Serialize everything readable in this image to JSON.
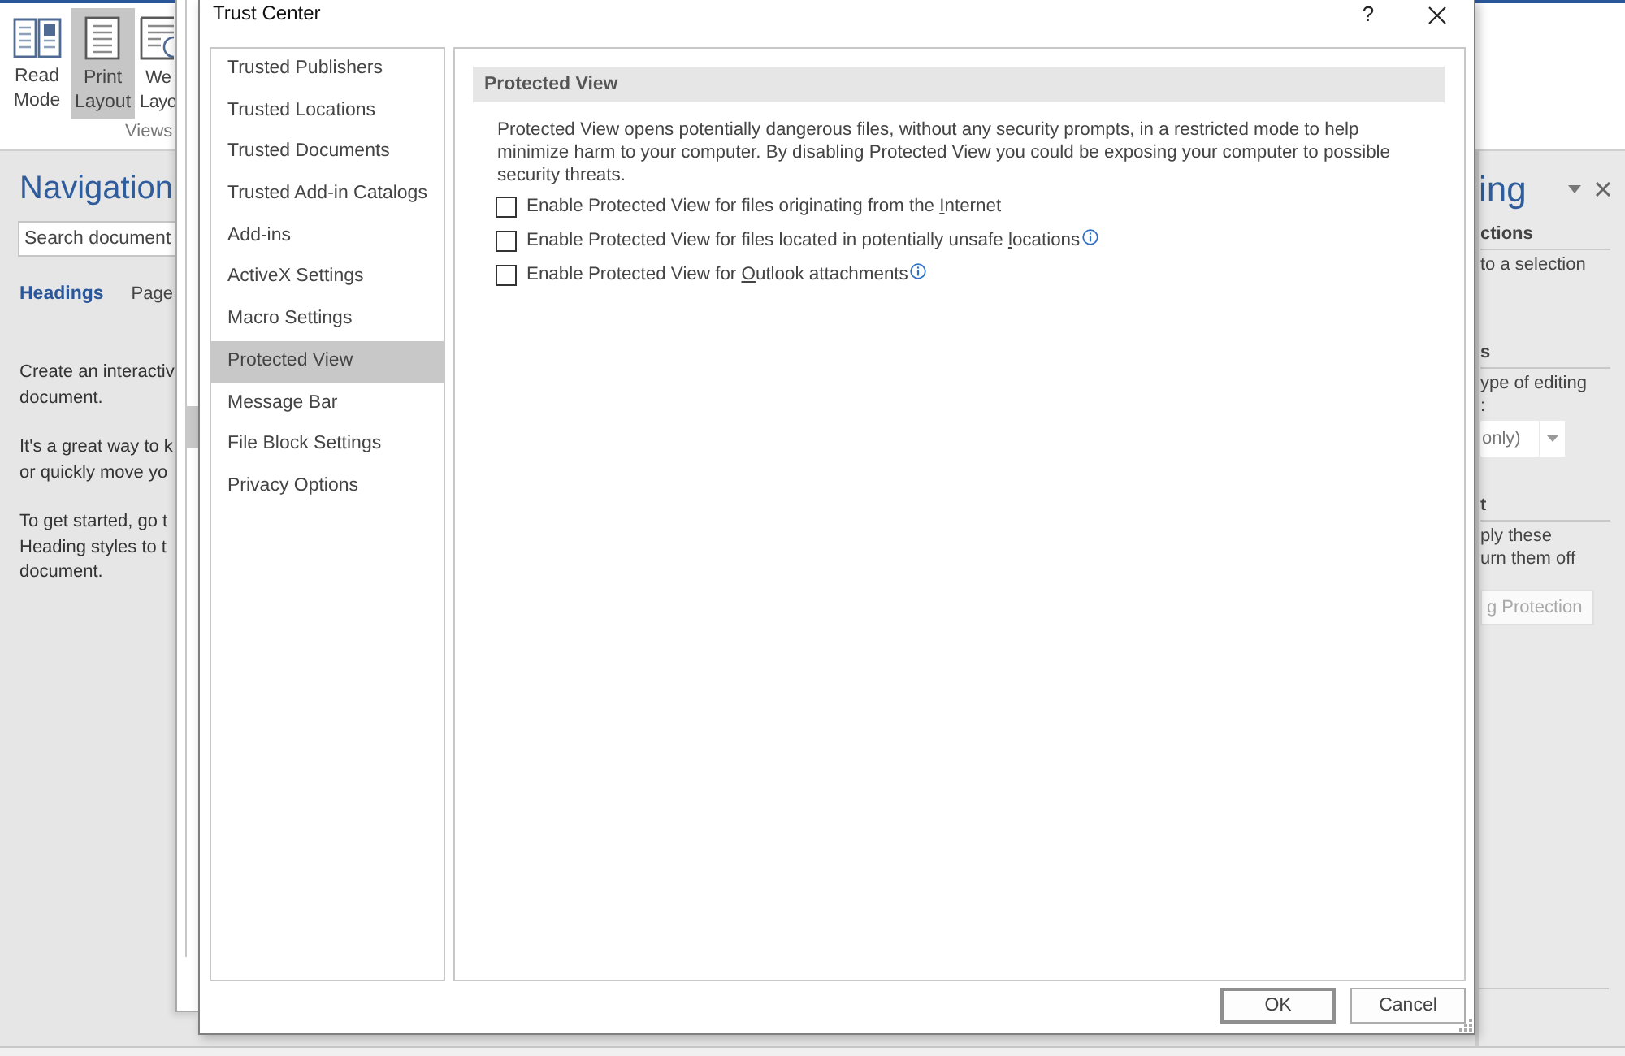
{
  "word_window": {
    "ribbon": {
      "views_group": {
        "label": "Views",
        "buttons": [
          {
            "kind": "read",
            "label_lines": [
              "Read",
              "Mode"
            ],
            "selected": false
          },
          {
            "kind": "print",
            "label_lines": [
              "Print",
              "Layout"
            ],
            "selected": true
          },
          {
            "kind": "web",
            "label_lines": [
              "We",
              "Layo"
            ],
            "selected": false
          }
        ]
      }
    },
    "navigation_pane": {
      "title": "Navigation",
      "search": {
        "placeholder": "Search document"
      },
      "tabs": [
        {
          "label": "Headings",
          "selected": true
        },
        {
          "label": "Page",
          "selected": false
        }
      ],
      "paragraphs": [
        {
          "lines": [
            "Create an interactiv",
            "document."
          ]
        },
        {
          "lines": [
            "It's a great way to k",
            "or quickly move yo"
          ]
        },
        {
          "lines": [
            "To get started, go t",
            "Heading styles to t",
            "document."
          ]
        }
      ]
    },
    "restrict_editing_pane": {
      "title": "ing",
      "sections": [
        {
          "heading": "ctions",
          "lines": [
            "to a selection"
          ]
        },
        {
          "heading": "s",
          "lines": [
            "ype of editing",
            ":"
          ],
          "dropdown": {
            "value": "only)"
          }
        },
        {
          "heading": "t",
          "lines": [
            "ply these",
            "urn them off"
          ],
          "button": {
            "label": "g Protection",
            "disabled": true
          }
        }
      ]
    }
  },
  "dialog": {
    "title": "Trust Center",
    "help_button": "?",
    "sidebar": {
      "items": [
        {
          "label": "Trusted Publishers",
          "selected": false
        },
        {
          "label": "Trusted Locations",
          "selected": false
        },
        {
          "label": "Trusted Documents",
          "selected": false
        },
        {
          "label": "Trusted Add-in Catalogs",
          "selected": false
        },
        {
          "label": "Add-ins",
          "selected": false
        },
        {
          "label": "ActiveX Settings",
          "selected": false
        },
        {
          "label": "Macro Settings",
          "selected": false
        },
        {
          "label": "Protected View",
          "selected": true
        },
        {
          "label": "Message Bar",
          "selected": false
        },
        {
          "label": "File Block Settings",
          "selected": false
        },
        {
          "label": "Privacy Options",
          "selected": false
        }
      ]
    },
    "content": {
      "heading": "Protected View",
      "description_lines": [
        "Protected View opens potentially dangerous files, without any security prompts, in a restricted mode to help",
        "minimize harm to your computer. By disabling Protected View you could be exposing your computer to possible",
        "security threats."
      ],
      "options": [
        {
          "before": "Enable Protected View for files originating from the ",
          "access_key": "I",
          "after": "nternet",
          "checked": false,
          "info_icon": false
        },
        {
          "before": "Enable Protected View for files located in potentially unsafe ",
          "access_key": "l",
          "after": "ocations",
          "checked": false,
          "info_icon": true
        },
        {
          "before": "Enable Protected View for ",
          "access_key": "O",
          "after": "utlook attachments",
          "checked": false,
          "info_icon": true
        }
      ]
    },
    "buttons": [
      {
        "label": "OK",
        "default": true
      },
      {
        "label": "Cancel",
        "default": false
      }
    ]
  }
}
